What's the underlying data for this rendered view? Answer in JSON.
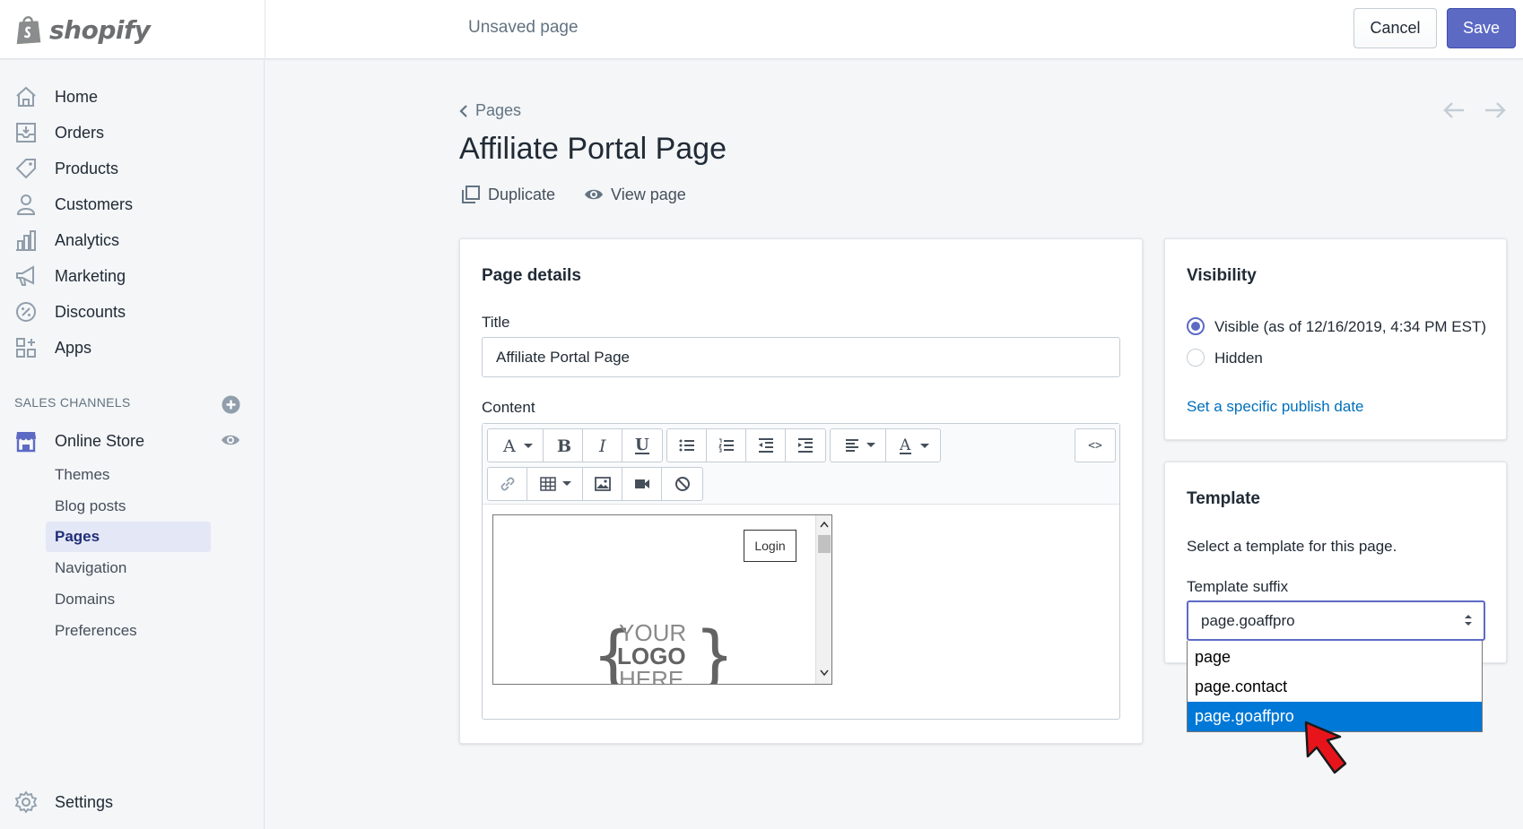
{
  "app": {
    "brand": "shopify",
    "page_status": "Unsaved page"
  },
  "header": {
    "cancel_label": "Cancel",
    "save_label": "Save"
  },
  "sidebar": {
    "items": [
      {
        "label": "Home",
        "icon": "home-icon"
      },
      {
        "label": "Orders",
        "icon": "orders-icon"
      },
      {
        "label": "Products",
        "icon": "tag-icon"
      },
      {
        "label": "Customers",
        "icon": "person-icon"
      },
      {
        "label": "Analytics",
        "icon": "bar-chart-icon"
      },
      {
        "label": "Marketing",
        "icon": "megaphone-icon"
      },
      {
        "label": "Discounts",
        "icon": "discount-icon"
      },
      {
        "label": "Apps",
        "icon": "apps-icon"
      }
    ],
    "sales_channels_heading": "SALES CHANNELS",
    "online_store": "Online Store",
    "sub_items": [
      "Themes",
      "Blog posts",
      "Pages",
      "Navigation",
      "Domains",
      "Preferences"
    ],
    "active_sub_item": "Pages",
    "settings": "Settings"
  },
  "main": {
    "breadcrumb": "Pages",
    "title": "Affiliate Portal Page",
    "actions": {
      "duplicate": "Duplicate",
      "view_page": "View page"
    }
  },
  "page_details": {
    "heading": "Page details",
    "title_label": "Title",
    "title_value": "Affiliate Portal Page",
    "content_label": "Content",
    "html_toggle": "<>",
    "preview": {
      "login_label": "Login",
      "logo_lines": [
        "YOUR",
        "LOGO",
        "HERE"
      ]
    }
  },
  "visibility": {
    "heading": "Visibility",
    "options": [
      {
        "label": "Visible (as of 12/16/2019, 4:34 PM EST)",
        "selected": true
      },
      {
        "label": "Hidden",
        "selected": false
      }
    ],
    "publish_link": "Set a specific publish date"
  },
  "template": {
    "heading": "Template",
    "description": "Select a template for this page.",
    "suffix_label": "Template suffix",
    "selected_value": "page.goaffpro",
    "options": [
      "page",
      "page.contact",
      "page.goaffpro"
    ],
    "highlighted_option": "page.goaffpro"
  },
  "colors": {
    "accent": "#5c6ac4",
    "link": "#006fbb",
    "active_nav_bg": "#e4e7f5",
    "dropdown_highlight": "#0078d7",
    "cursor_arrow": "#e8141b"
  }
}
